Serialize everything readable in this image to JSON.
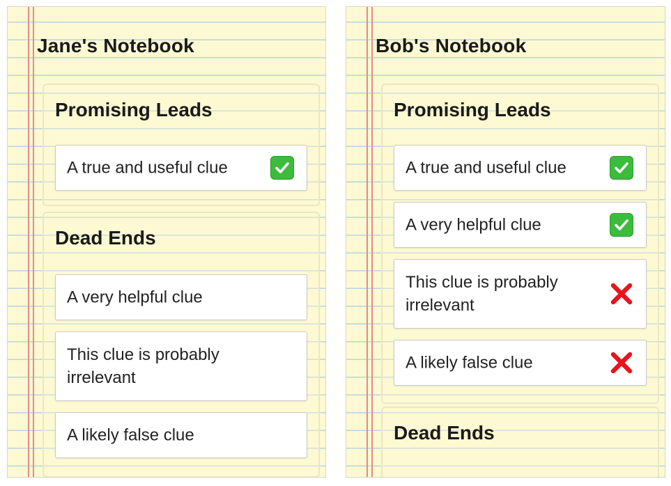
{
  "notebooks": [
    {
      "title": "Jane's Notebook",
      "sections": {
        "promising": {
          "title": "Promising Leads",
          "clues": [
            {
              "text": "A true and useful clue",
              "mark": "check-mark-icon"
            }
          ]
        },
        "dead_ends": {
          "title": "Dead Ends",
          "clues": [
            {
              "text": "A very helpful clue"
            },
            {
              "text": "This clue is probably irrelevant"
            },
            {
              "text": "A likely false clue"
            }
          ]
        }
      }
    },
    {
      "title": "Bob's Notebook",
      "sections": {
        "promising": {
          "title": "Promising Leads",
          "clues": [
            {
              "text": "A true and useful clue",
              "mark": "check-mark-icon"
            },
            {
              "text": "A very helpful clue",
              "mark": "check-mark-icon"
            },
            {
              "text": "This clue is probably irrelevant",
              "mark": "cross-mark-icon"
            },
            {
              "text": "A likely false clue",
              "mark": "cross-mark-icon"
            }
          ]
        },
        "dead_ends": {
          "title": "Dead Ends",
          "clues": []
        }
      }
    }
  ],
  "colors": {
    "paper": "#fdf9d3",
    "rule_line": "#b9d3e3",
    "margin_line": "#e48a8a",
    "check_green": "#3dbb3d",
    "cross_red": "#e8141e"
  }
}
